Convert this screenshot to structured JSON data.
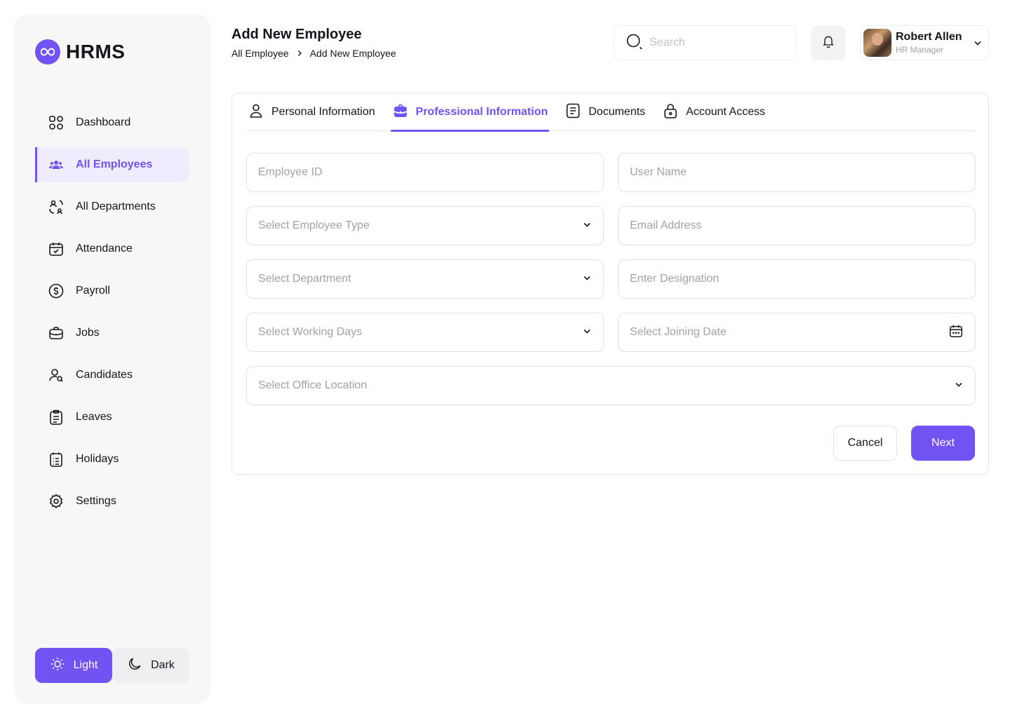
{
  "app": {
    "logo_text": "HRMS",
    "logo_icon": "infinity-icon",
    "accent_color": "#7152f3"
  },
  "sidebar": {
    "items": [
      {
        "label": "Dashboard",
        "icon": "grid-icon",
        "active": false
      },
      {
        "label": "All Employees",
        "icon": "users-icon",
        "active": true
      },
      {
        "label": "All Departments",
        "icon": "departments-icon",
        "active": false
      },
      {
        "label": "Attendance",
        "icon": "calendar-check-icon",
        "active": false
      },
      {
        "label": "Payroll",
        "icon": "dollar-circle-icon",
        "active": false
      },
      {
        "label": "Jobs",
        "icon": "briefcase-icon",
        "active": false
      },
      {
        "label": "Candidates",
        "icon": "candidates-icon",
        "active": false
      },
      {
        "label": "Leaves",
        "icon": "clipboard-icon",
        "active": false
      },
      {
        "label": "Holidays",
        "icon": "list-icon",
        "active": false
      },
      {
        "label": "Settings",
        "icon": "gear-icon",
        "active": false
      }
    ],
    "theme": {
      "light_label": "Light",
      "dark_label": "Dark",
      "selected": "Light"
    }
  },
  "header": {
    "title": "Add New Employee",
    "breadcrumb": [
      "All Employee",
      "Add New Employee"
    ],
    "search_placeholder": "Search",
    "user": {
      "name": "Robert Allen",
      "role": "HR Manager"
    }
  },
  "tabs": [
    {
      "label": "Personal Information",
      "icon": "user-icon",
      "active": false
    },
    {
      "label": "Professional Information",
      "icon": "briefcase-icon",
      "active": true
    },
    {
      "label": "Documents",
      "icon": "document-icon",
      "active": false
    },
    {
      "label": "Account Access",
      "icon": "lock-icon",
      "active": false
    }
  ],
  "form": {
    "employee_id": "Employee ID",
    "user_name": "User Name",
    "employee_type": "Select Employee Type",
    "email": "Email Address",
    "department": "Select Department",
    "designation": "Enter Designation",
    "working_days": "Select Working Days",
    "joining_date": "Select Joining Date",
    "office_location": "Select Office Location"
  },
  "actions": {
    "cancel": "Cancel",
    "next": "Next"
  }
}
